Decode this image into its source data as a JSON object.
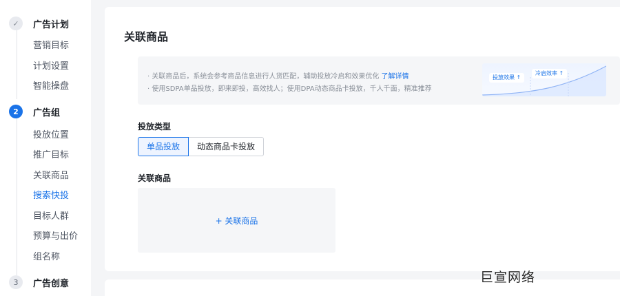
{
  "sidebar": {
    "steps": [
      {
        "index": "",
        "state": "done",
        "title": "广告计划",
        "items": [
          "营销目标",
          "计划设置",
          "智能操盘"
        ]
      },
      {
        "index": "2",
        "state": "active",
        "title": "广告组",
        "items": [
          "投放位置",
          "推广目标",
          "关联商品",
          "搜索快投",
          "目标人群",
          "预算与出价",
          "组名称"
        ]
      },
      {
        "index": "3",
        "state": "todo",
        "title": "广告创意",
        "items": []
      }
    ],
    "current_item": "搜索快投",
    "check_icon": "✓"
  },
  "main": {
    "title": "关联商品",
    "tips": {
      "line1_prefix": "· 关联商品后，系统会参考商品信息进行人货匹配，辅助投放冷启和效果优化",
      "line1_link": "了解详情",
      "line2": "· 使用SDPA单品投放，即来即投，高效找人；使用DPA动态商品卡投放，千人千面，精准推荐",
      "badge_effect": "投放效果 ↑",
      "badge_coldstart": "冷启效率 ↑"
    },
    "delivery_type": {
      "label": "投放类型",
      "options": [
        "单品投放",
        "动态商品卡投放"
      ],
      "selected": "单品投放"
    },
    "products": {
      "label": "关联商品",
      "add_label": "+ 关联商品"
    }
  },
  "watermark": "巨宣网络",
  "colors": {
    "accent": "#1a73e8",
    "panel": "#f5f6f8",
    "background": "#f4f5f7"
  }
}
